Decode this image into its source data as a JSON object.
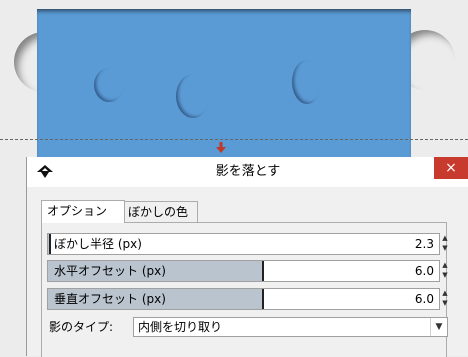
{
  "dialog": {
    "title": "影を落とす",
    "close_icon": "×"
  },
  "tabs": [
    {
      "label": "オプション",
      "active": true
    },
    {
      "label": "ぼかしの色",
      "active": false
    }
  ],
  "fields": {
    "blur_radius": {
      "label": "ぼかし半径 (px)",
      "value": "2.3",
      "fill": 0.0
    },
    "horizontal_offset": {
      "label": "水平オフセット (px)",
      "value": "6.0",
      "fill": 0.55
    },
    "vertical_offset": {
      "label": "垂直オフセット (px)",
      "value": "6.0",
      "fill": 0.55
    }
  },
  "shadow_type": {
    "label": "影のタイプ:",
    "selected": "内側を切り取り"
  },
  "colors": {
    "canvas_fill": "#5b9bd5",
    "close_button": "#c83a2d",
    "slider_fill": "#b9c4cf"
  },
  "icons": {
    "app": "inkscape-icon",
    "handle": "arrow-handle-icon",
    "spin_up": "▲",
    "spin_down": "▼",
    "dropdown": "▼"
  }
}
